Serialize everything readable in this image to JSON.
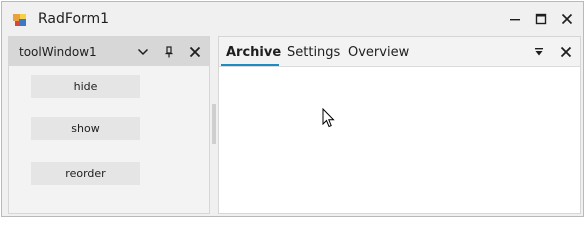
{
  "window": {
    "title": "RadForm1",
    "icon": "radform-app-icon",
    "controls": [
      "minimize-icon",
      "maximize-icon",
      "close-icon"
    ]
  },
  "tool_window": {
    "title": "toolWindow1",
    "header_icons": [
      "chevron-down-icon",
      "pin-icon",
      "close-icon"
    ],
    "buttons": [
      "hide",
      "show",
      "reorder"
    ]
  },
  "document_window": {
    "tabs": [
      "Archive",
      "Settings",
      "Overview"
    ],
    "active_tab": "Archive",
    "header_icons": [
      "overflow-dropdown-icon",
      "close-icon"
    ],
    "accent_color": "#1e8bc3"
  }
}
